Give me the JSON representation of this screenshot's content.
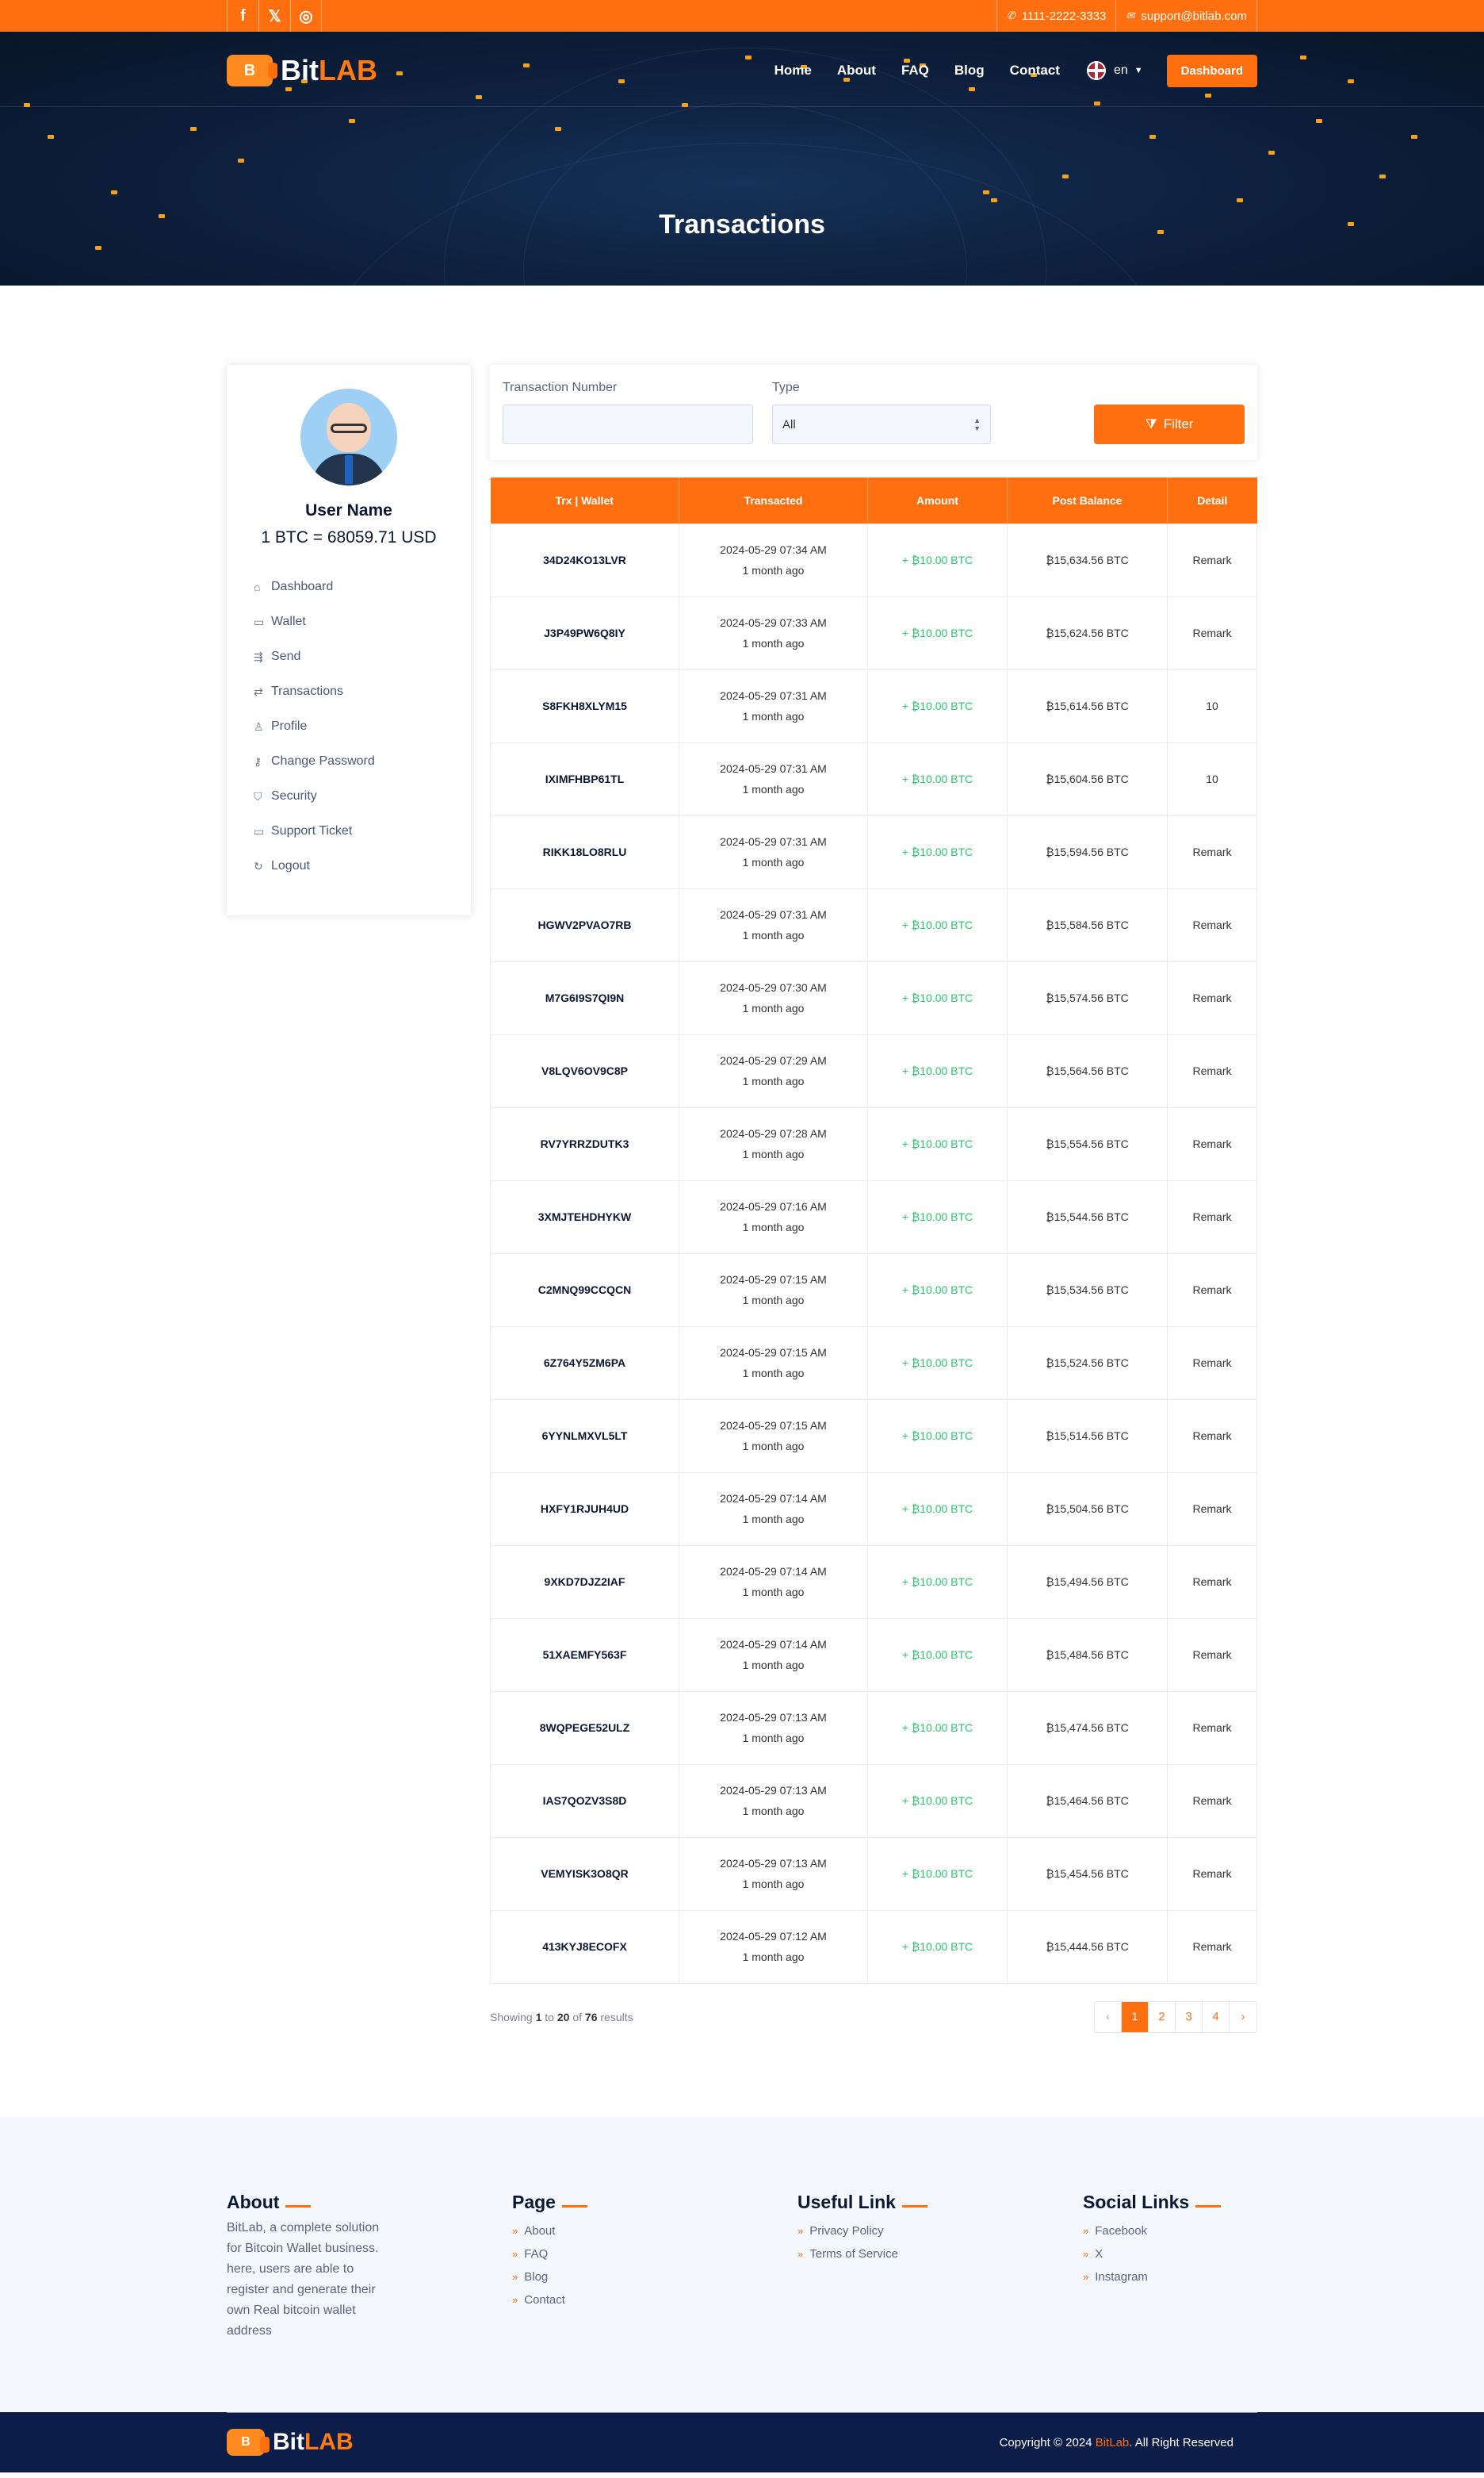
{
  "topbar": {
    "socials": [
      "f",
      "𝕏",
      "◎"
    ],
    "phone": "1111-2222-3333",
    "email": "support@bitlab.com"
  },
  "brand": {
    "part1": "Bit",
    "part2": "LAB",
    "mark": "B"
  },
  "nav": {
    "items": [
      "Home",
      "About",
      "FAQ",
      "Blog",
      "Contact"
    ],
    "lang": "en",
    "dashboard": "Dashboard"
  },
  "hero": {
    "title": "Transactions"
  },
  "sidebar": {
    "user_name": "User Name",
    "rate": "1 BTC = 68059.71 USD",
    "items": [
      {
        "label": "Dashboard",
        "icon": "⌂"
      },
      {
        "label": "Wallet",
        "icon": "▭"
      },
      {
        "label": "Send",
        "icon": "⇶"
      },
      {
        "label": "Transactions",
        "icon": "⇄"
      },
      {
        "label": "Profile",
        "icon": "♙"
      },
      {
        "label": "Change Password",
        "icon": "⚷"
      },
      {
        "label": "Security",
        "icon": "⛉"
      },
      {
        "label": "Support Ticket",
        "icon": "▭"
      },
      {
        "label": "Logout",
        "icon": "↻"
      }
    ]
  },
  "filter": {
    "trx_label": "Transaction Number",
    "trx_value": "",
    "type_label": "Type",
    "type_value": "All",
    "button": "Filter"
  },
  "table": {
    "headers": [
      "Trx | Wallet",
      "Transacted",
      "Amount",
      "Post Balance",
      "Detail"
    ],
    "rows": [
      [
        "34D24KO13LVR",
        "2024-05-29 07:34 AM",
        "1 month ago",
        "+ ₿10.00 BTC",
        "₿15,634.56 BTC",
        "Remark"
      ],
      [
        "J3P49PW6Q8IY",
        "2024-05-29 07:33 AM",
        "1 month ago",
        "+ ₿10.00 BTC",
        "₿15,624.56 BTC",
        "Remark"
      ],
      [
        "S8FKH8XLYM15",
        "2024-05-29 07:31 AM",
        "1 month ago",
        "+ ₿10.00 BTC",
        "₿15,614.56 BTC",
        "10"
      ],
      [
        "IXIMFHBP61TL",
        "2024-05-29 07:31 AM",
        "1 month ago",
        "+ ₿10.00 BTC",
        "₿15,604.56 BTC",
        "10"
      ],
      [
        "RIKK18LO8RLU",
        "2024-05-29 07:31 AM",
        "1 month ago",
        "+ ₿10.00 BTC",
        "₿15,594.56 BTC",
        "Remark"
      ],
      [
        "HGWV2PVAO7RB",
        "2024-05-29 07:31 AM",
        "1 month ago",
        "+ ₿10.00 BTC",
        "₿15,584.56 BTC",
        "Remark"
      ],
      [
        "M7G6I9S7QI9N",
        "2024-05-29 07:30 AM",
        "1 month ago",
        "+ ₿10.00 BTC",
        "₿15,574.56 BTC",
        "Remark"
      ],
      [
        "V8LQV6OV9C8P",
        "2024-05-29 07:29 AM",
        "1 month ago",
        "+ ₿10.00 BTC",
        "₿15,564.56 BTC",
        "Remark"
      ],
      [
        "RV7YRRZDUTK3",
        "2024-05-29 07:28 AM",
        "1 month ago",
        "+ ₿10.00 BTC",
        "₿15,554.56 BTC",
        "Remark"
      ],
      [
        "3XMJTEHDHYKW",
        "2024-05-29 07:16 AM",
        "1 month ago",
        "+ ₿10.00 BTC",
        "₿15,544.56 BTC",
        "Remark"
      ],
      [
        "C2MNQ99CCQCN",
        "2024-05-29 07:15 AM",
        "1 month ago",
        "+ ₿10.00 BTC",
        "₿15,534.56 BTC",
        "Remark"
      ],
      [
        "6Z764Y5ZM6PA",
        "2024-05-29 07:15 AM",
        "1 month ago",
        "+ ₿10.00 BTC",
        "₿15,524.56 BTC",
        "Remark"
      ],
      [
        "6YYNLMXVL5LT",
        "2024-05-29 07:15 AM",
        "1 month ago",
        "+ ₿10.00 BTC",
        "₿15,514.56 BTC",
        "Remark"
      ],
      [
        "HXFY1RJUH4UD",
        "2024-05-29 07:14 AM",
        "1 month ago",
        "+ ₿10.00 BTC",
        "₿15,504.56 BTC",
        "Remark"
      ],
      [
        "9XKD7DJZ2IAF",
        "2024-05-29 07:14 AM",
        "1 month ago",
        "+ ₿10.00 BTC",
        "₿15,494.56 BTC",
        "Remark"
      ],
      [
        "51XAEMFY563F",
        "2024-05-29 07:14 AM",
        "1 month ago",
        "+ ₿10.00 BTC",
        "₿15,484.56 BTC",
        "Remark"
      ],
      [
        "8WQPEGE52ULZ",
        "2024-05-29 07:13 AM",
        "1 month ago",
        "+ ₿10.00 BTC",
        "₿15,474.56 BTC",
        "Remark"
      ],
      [
        "IAS7QOZV3S8D",
        "2024-05-29 07:13 AM",
        "1 month ago",
        "+ ₿10.00 BTC",
        "₿15,464.56 BTC",
        "Remark"
      ],
      [
        "VEMYISK3O8QR",
        "2024-05-29 07:13 AM",
        "1 month ago",
        "+ ₿10.00 BTC",
        "₿15,454.56 BTC",
        "Remark"
      ],
      [
        "413KYJ8ECOFX",
        "2024-05-29 07:12 AM",
        "1 month ago",
        "+ ₿10.00 BTC",
        "₿15,444.56 BTC",
        "Remark"
      ]
    ]
  },
  "pagination": {
    "showing": "Showing",
    "from": "1",
    "to_word": "to",
    "to": "20",
    "of_word": "of",
    "total": "76",
    "results": "results",
    "prev": "‹",
    "pages": [
      "1",
      "2",
      "3",
      "4"
    ],
    "next": "›"
  },
  "footer": {
    "about_title": "About",
    "about_text": "BitLab, a complete solution for Bitcoin Wallet business. here, users are able to register and generate their own Real bitcoin wallet address",
    "page_title": "Page",
    "page_links": [
      "About",
      "FAQ",
      "Blog",
      "Contact"
    ],
    "useful_title": "Useful Link",
    "useful_links": [
      "Privacy Policy",
      "Terms of Service"
    ],
    "social_title": "Social Links",
    "social_links": [
      "Facebook",
      "X",
      "Instagram"
    ],
    "copyright_pre": "Copyright © 2024",
    "copyright_brand": "BitLab",
    "copyright_post": ". All Right Reserved"
  },
  "colors": {
    "accent": "#ff6f0f",
    "navy": "#0c1d4a",
    "positive": "#28c56f"
  }
}
